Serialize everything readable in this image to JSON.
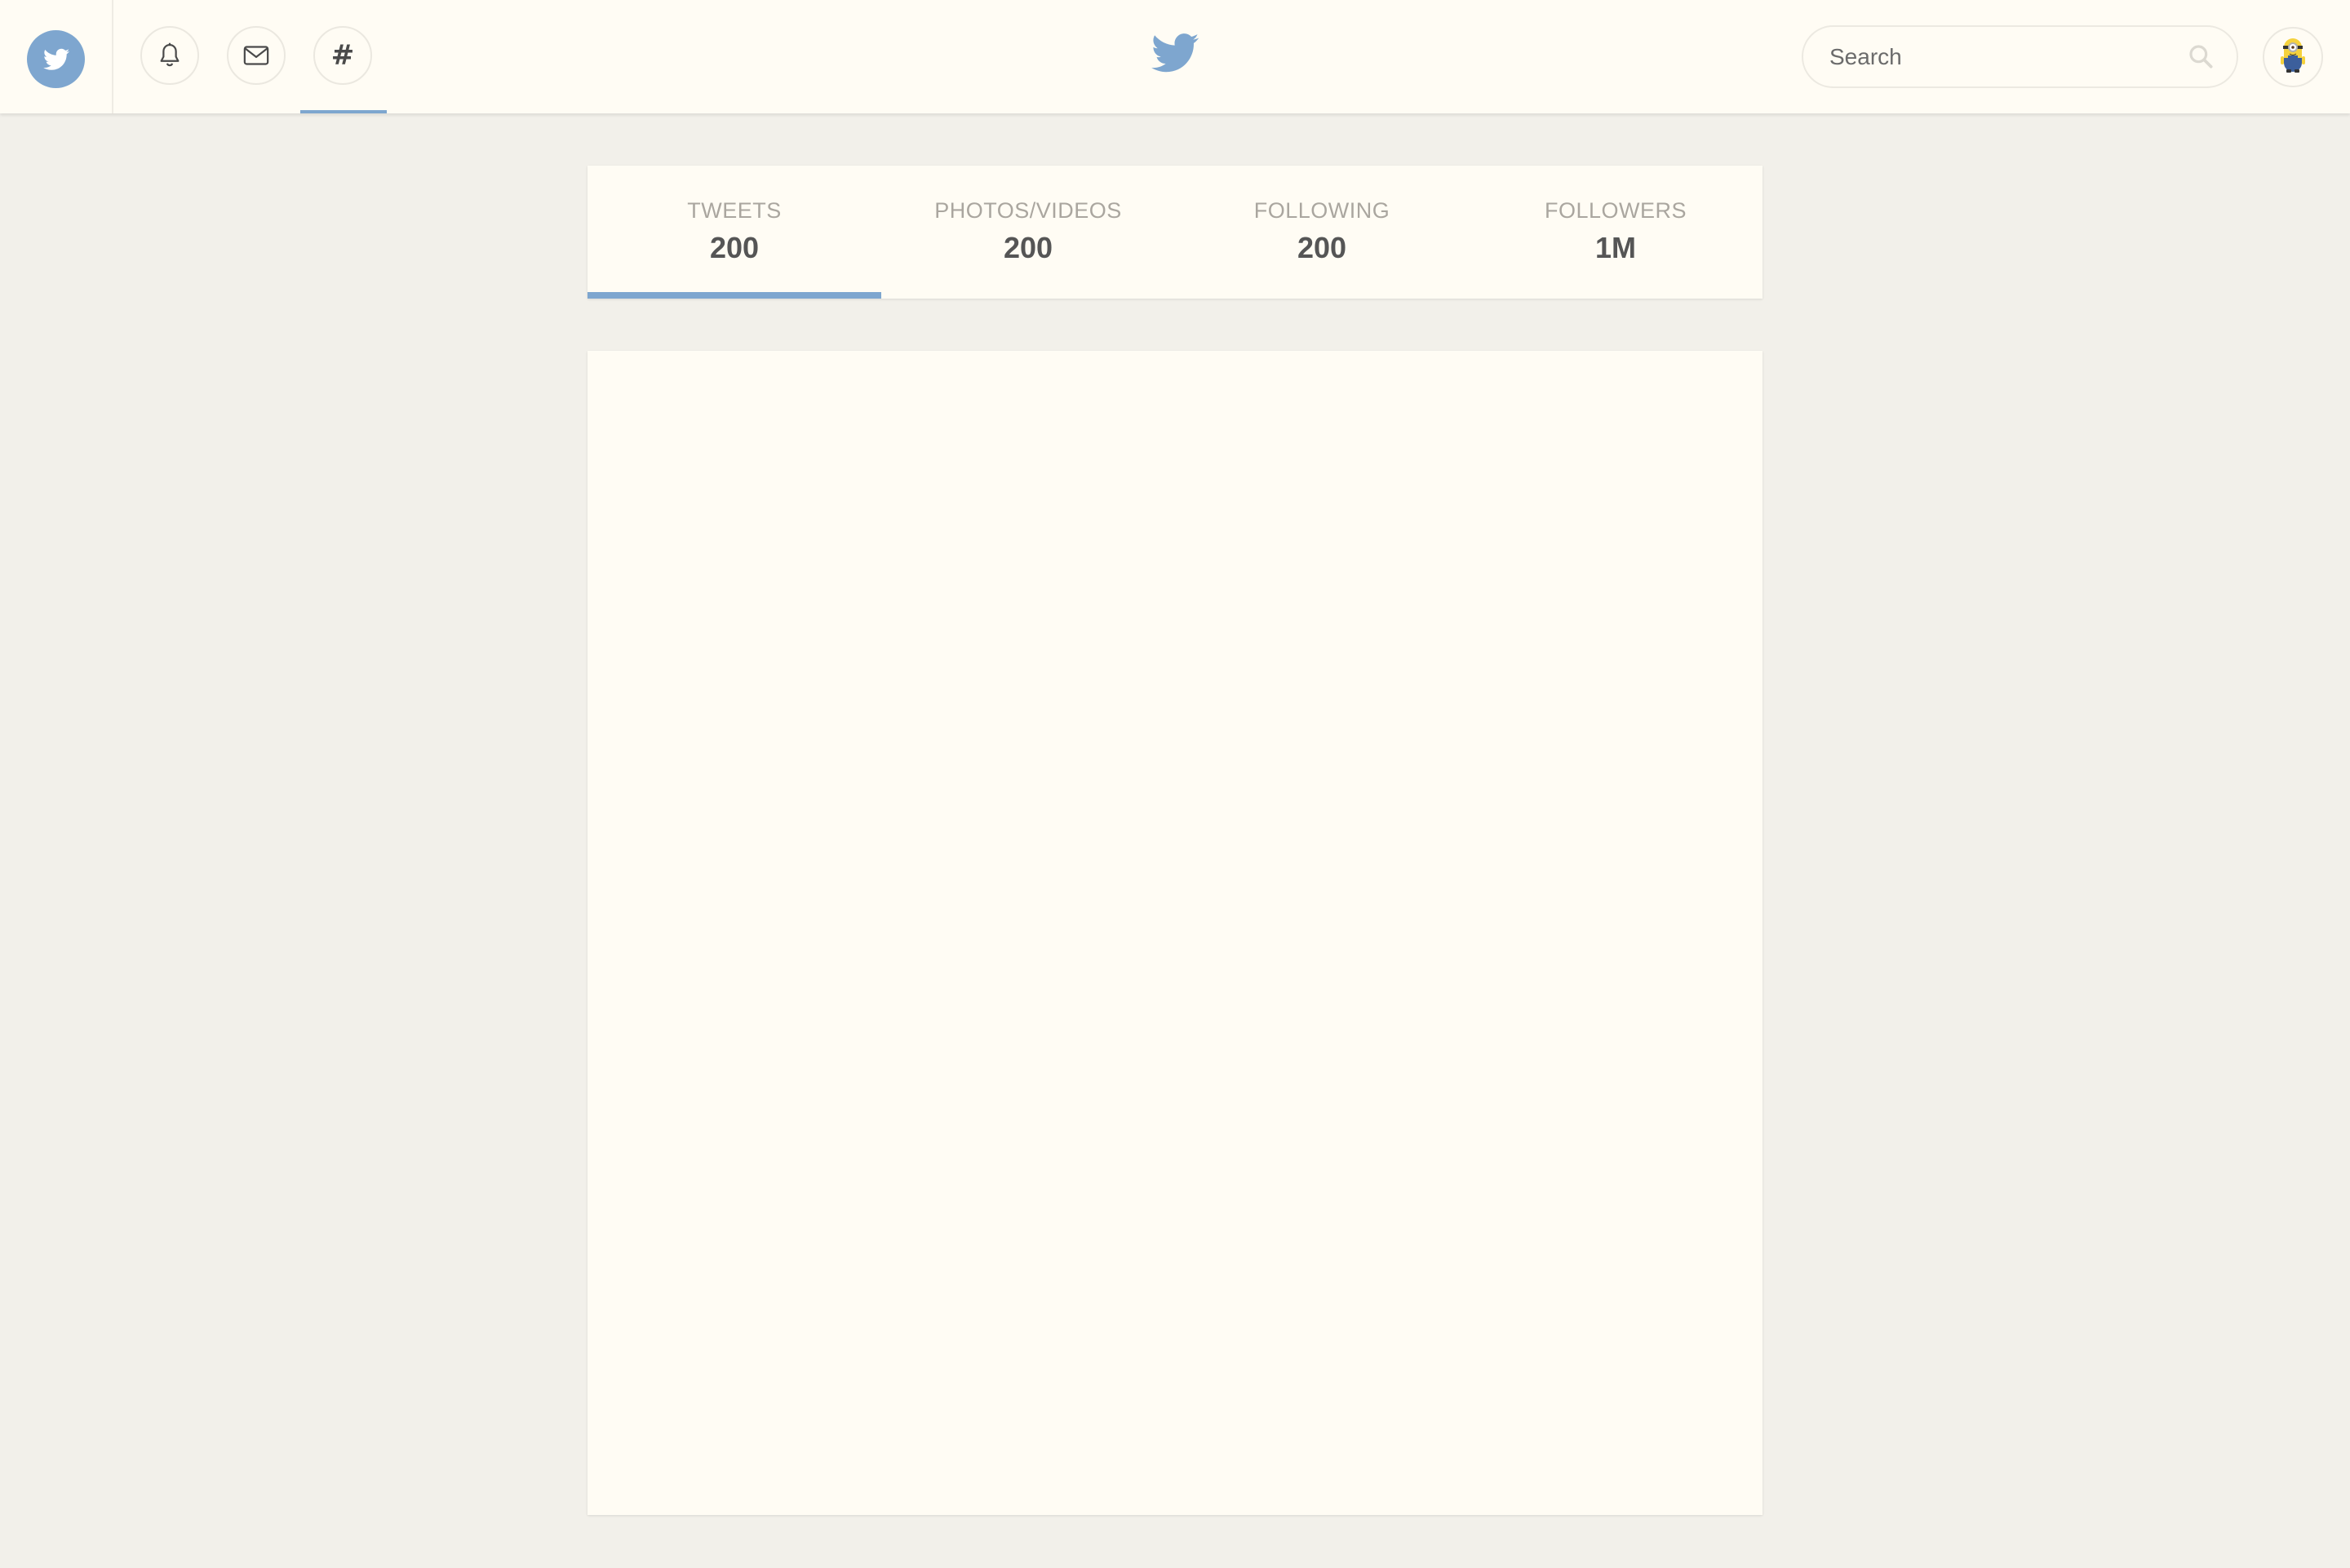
{
  "colors": {
    "accent": "#7ea6cf",
    "page_background": "#f2f0ea",
    "surface": "#fffcf4",
    "label_text": "#aaa69f",
    "value_text": "#555555"
  },
  "topbar": {
    "home_icon": "twitter-bird-icon",
    "nav_icons": [
      "bell-icon",
      "mail-icon",
      "hashtag-icon"
    ],
    "active_nav": "hashtag",
    "hashtag_glyph": "#",
    "center_logo_icon": "twitter-bird-icon",
    "search": {
      "placeholder": "Search",
      "icon": "search-icon"
    },
    "avatar_icon": "minion-avatar"
  },
  "stats": [
    {
      "label": "TWEETS",
      "value": "200"
    },
    {
      "label": "PHOTOS/VIDEOS",
      "value": "200"
    },
    {
      "label": "FOLLOWING",
      "value": "200"
    },
    {
      "label": "FOLLOWERS",
      "value": "1M"
    }
  ],
  "active_stat": "TWEETS"
}
